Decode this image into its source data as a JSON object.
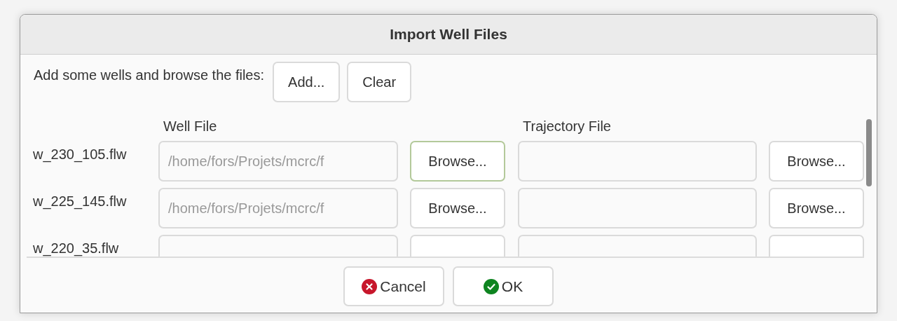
{
  "window": {
    "title": "Import Well Files"
  },
  "instruction": "Add some wells and browse the files:",
  "toolbar_buttons": [
    "Add...",
    "Clear"
  ],
  "columns": [
    "Well File",
    "Trajectory File"
  ],
  "wells": [
    {
      "name": "w_230_105.flw",
      "well_file": "/home/fors/Projets/mcrc/f",
      "browse_buttons": [
        "Browse...",
        "Browse..."
      ],
      "focused": true
    },
    {
      "name": "w_225_145.flw",
      "well_file": "/home/fors/Projets/mcrc/f",
      "browse_buttons": [
        "Browse...",
        "Browse..."
      ],
      "focused": false
    },
    {
      "name": "w_220_35.flw",
      "focused": false
    }
  ],
  "footer_buttons": [
    {
      "label": "Cancel",
      "kind": "cancel"
    },
    {
      "label": "OK",
      "kind": "ok"
    }
  ]
}
